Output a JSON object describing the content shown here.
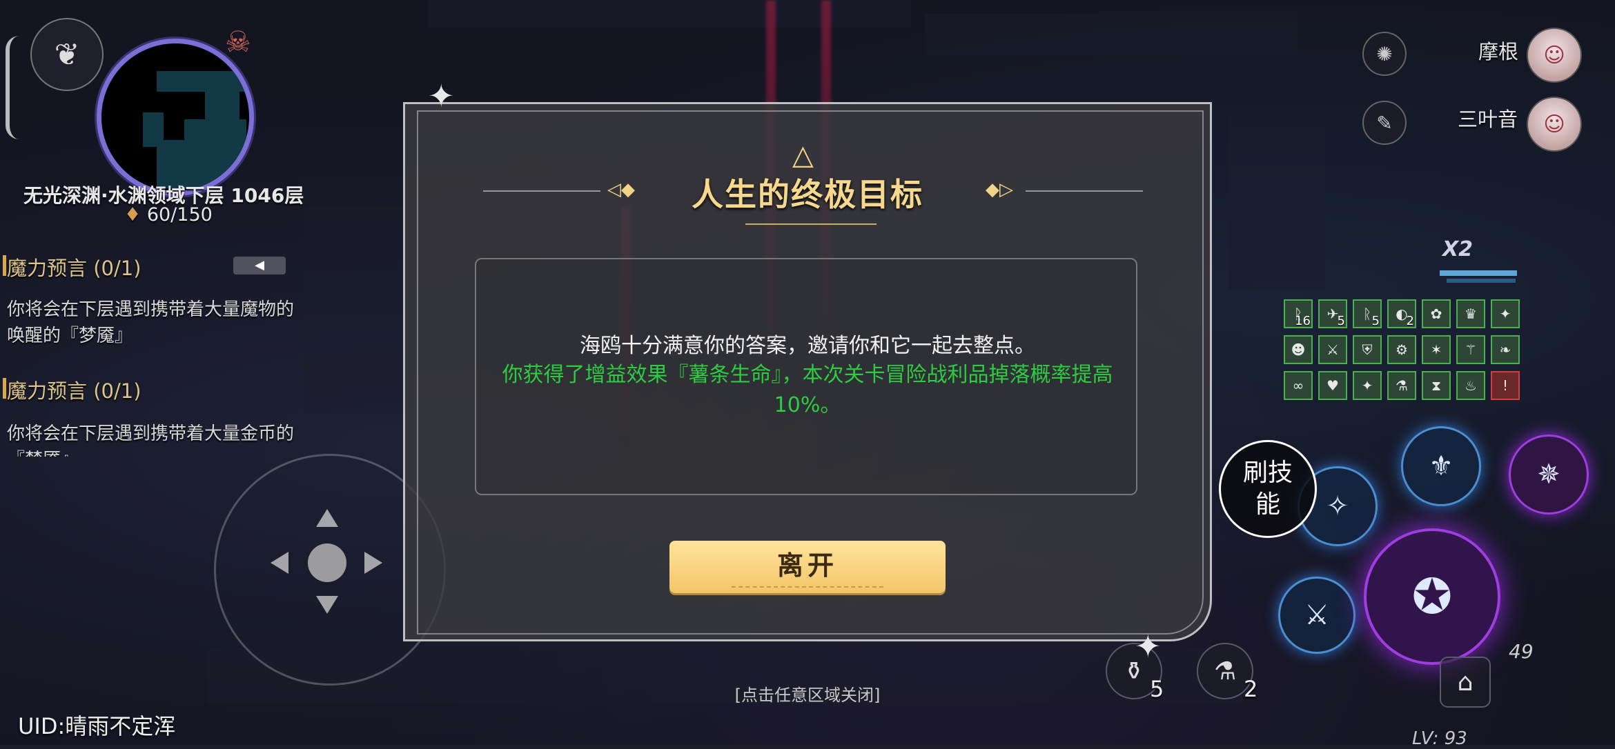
{
  "hud_left": {
    "zone_name": "无光深渊·水渊领域下层 1046层",
    "lamp_value": "60/150",
    "quests": [
      {
        "title": "魔力预言 (0/1)",
        "desc": "你将会在下层遇到携带着大量魔物的唤醒的『梦魇』"
      },
      {
        "title": "魔力预言 (0/1)",
        "desc": "你将会在下层遇到携带着大量金币的『梦魇』"
      }
    ],
    "uid": "UID:晴雨不定浑"
  },
  "hud_right": {
    "team": [
      {
        "name": "摩根",
        "icon": "flame-icon"
      },
      {
        "name": "三叶音",
        "icon": "feather-icon"
      }
    ],
    "multiplier": "X2",
    "buffs": [
      {
        "icon": "rune",
        "count": "16"
      },
      {
        "icon": "bird",
        "count": "5"
      },
      {
        "icon": "rune",
        "count": "5"
      },
      {
        "icon": "shell",
        "count": "2"
      },
      {
        "icon": "flower",
        "count": ""
      },
      {
        "icon": "crown",
        "count": ""
      },
      {
        "icon": "paw",
        "count": ""
      },
      {
        "icon": "mask",
        "count": ""
      },
      {
        "icon": "sword",
        "count": ""
      },
      {
        "icon": "shield",
        "count": ""
      },
      {
        "icon": "gear",
        "count": ""
      },
      {
        "icon": "star",
        "count": ""
      },
      {
        "icon": "wand",
        "count": ""
      },
      {
        "icon": "leaf",
        "count": ""
      },
      {
        "icon": "chain",
        "count": ""
      },
      {
        "icon": "heart",
        "count": ""
      },
      {
        "icon": "paw",
        "count": ""
      },
      {
        "icon": "bottle",
        "count": ""
      },
      {
        "icon": "hourglass",
        "count": ""
      },
      {
        "icon": "candle",
        "count": ""
      },
      {
        "icon": "alert",
        "count": ""
      }
    ],
    "refresh_skill_label": "刷技能",
    "potion_red_count": "5",
    "potion_blue_count": "2",
    "extra_number": "49",
    "level": "LV: 93"
  },
  "dialog": {
    "title": "人生的终极目标",
    "message": "海鸥十分满意你的答案，邀请你和它一起去整点。",
    "reward": "你获得了增益效果『薯条生命』，本次关卡冒险战利品掉落概率提高10%。",
    "leave_label": "离开"
  },
  "close_hint": "[点击任意区域关闭]"
}
